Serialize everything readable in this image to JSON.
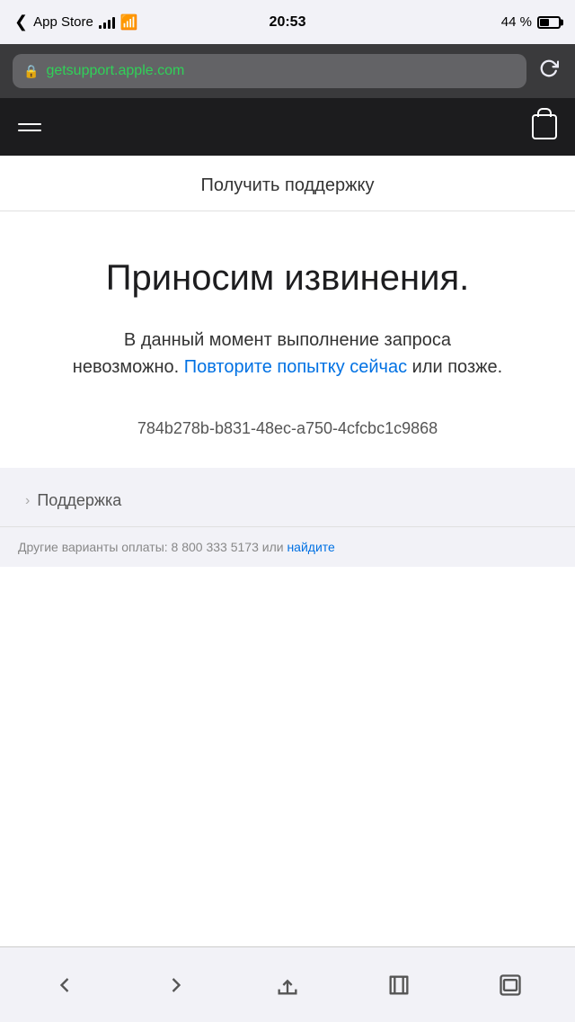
{
  "statusBar": {
    "carrier": "App Store",
    "time": "20:53",
    "batteryPercent": "44 %"
  },
  "urlBar": {
    "url": "getsupport.apple.com",
    "lockColor": "#30d158"
  },
  "navBar": {
    "menuLabel": "menu",
    "bagLabel": "bag"
  },
  "pageTitle": "Получить поддержку",
  "errorSection": {
    "title": "Приносим извинения.",
    "bodyText": "В данный момент выполнение запроса невозможно. ",
    "retryLinkText": "Повторите попытку сейчас",
    "afterLink": " или позже.",
    "errorCode": "784b278b-b831-48ec-a750-4cfcbc1c9868"
  },
  "breadcrumb": {
    "supportText": "Поддержка"
  },
  "footer": {
    "text": "Другие варианты оплаты: 8 800 333 5173 или ",
    "linkText": "найдите"
  },
  "bottomNav": {
    "back": "‹",
    "forward": "›",
    "share": "share",
    "bookmarks": "bookmarks",
    "tabs": "tabs"
  }
}
